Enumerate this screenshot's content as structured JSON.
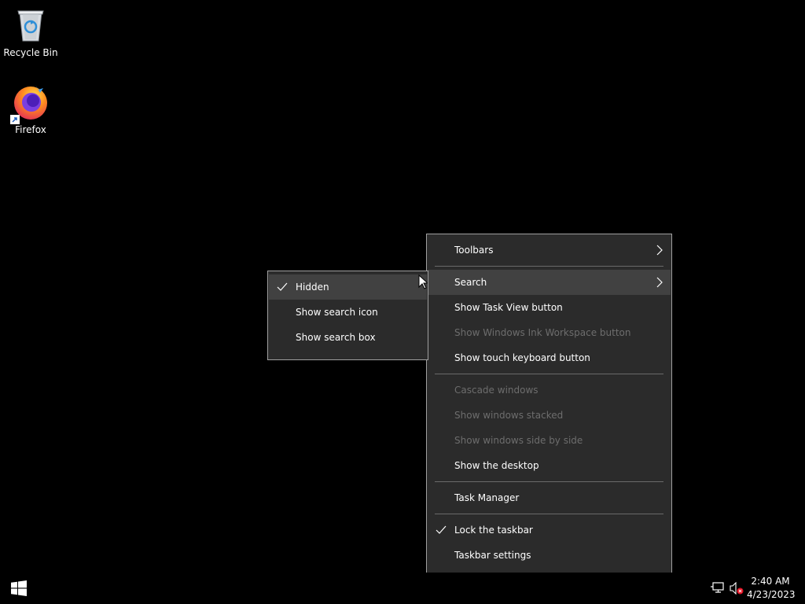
{
  "desktop": {
    "icons": [
      {
        "label": "Recycle Bin",
        "icon": "recycle-bin-icon"
      },
      {
        "label": "Firefox",
        "icon": "firefox-icon"
      }
    ]
  },
  "taskbar_menu": {
    "items": [
      {
        "label": "Toolbars",
        "enabled": true,
        "submenu": true
      },
      {
        "label": "Search",
        "enabled": true,
        "submenu": true,
        "highlighted": true
      },
      {
        "label": "Show Task View button",
        "enabled": true
      },
      {
        "label": "Show Windows Ink Workspace button",
        "enabled": false
      },
      {
        "label": "Show touch keyboard button",
        "enabled": true
      },
      {
        "label": "Cascade windows",
        "enabled": false
      },
      {
        "label": "Show windows stacked",
        "enabled": false
      },
      {
        "label": "Show windows side by side",
        "enabled": false
      },
      {
        "label": "Show the desktop",
        "enabled": true
      },
      {
        "label": "Task Manager",
        "enabled": true
      },
      {
        "label": "Lock the taskbar",
        "enabled": true,
        "checked": true
      },
      {
        "label": "Taskbar settings",
        "enabled": true
      }
    ]
  },
  "search_submenu": {
    "items": [
      {
        "label": "Hidden",
        "checked": true,
        "highlighted": true
      },
      {
        "label": "Show search icon",
        "checked": false
      },
      {
        "label": "Show search box",
        "checked": false
      }
    ]
  },
  "taskbar": {
    "start_icon": "windows-logo-icon",
    "tray_icons": [
      "network-icon",
      "volume-muted-icon"
    ],
    "clock": {
      "time": "2:40 AM",
      "date": "4/23/2023"
    }
  },
  "colors": {
    "menu_bg": "#2b2b2b",
    "menu_highlight": "#414141",
    "menu_border": "#a0a0a0",
    "disabled_text": "#6d6d6d",
    "desktop_bg": "#000000"
  }
}
